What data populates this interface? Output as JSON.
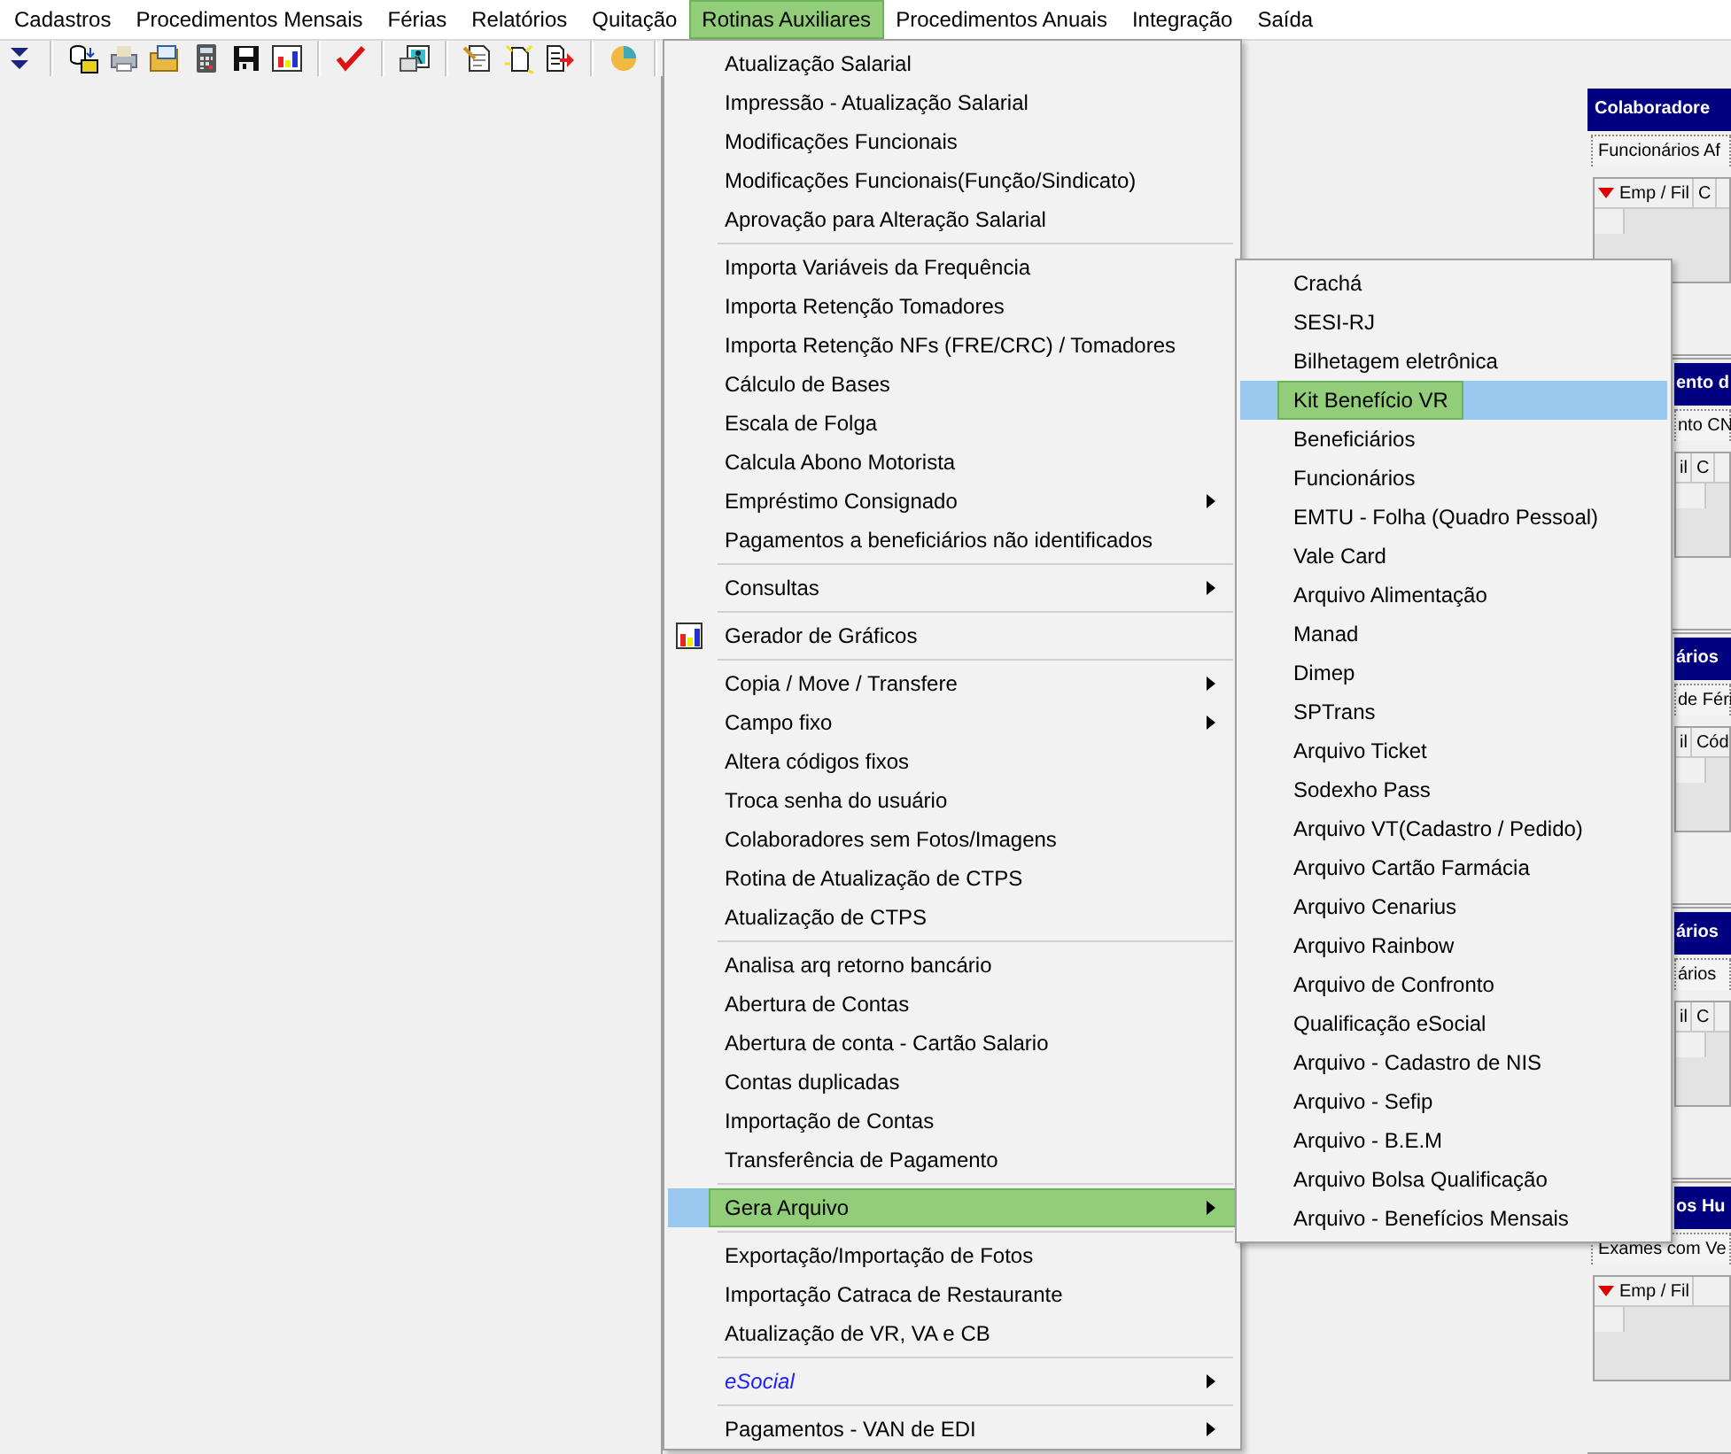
{
  "menubar": [
    {
      "label": "Cadastros",
      "selected": false
    },
    {
      "label": "Procedimentos Mensais",
      "selected": false
    },
    {
      "label": "Férias",
      "selected": false
    },
    {
      "label": "Relatórios",
      "selected": false
    },
    {
      "label": "Quitação",
      "selected": false
    },
    {
      "label": "Rotinas Auxiliares",
      "selected": true
    },
    {
      "label": "Procedimentos Anuais",
      "selected": false
    },
    {
      "label": "Integração",
      "selected": false
    },
    {
      "label": "Saída",
      "selected": false
    }
  ],
  "panels": [
    {
      "title": "Colaboradore",
      "tab": "Funcionários Af",
      "columns": [
        "Emp / Fil",
        "C"
      ],
      "sort_marker": true,
      "title_covered": false,
      "body_covered": false
    },
    {
      "title": "ento d",
      "tab": "nto CN",
      "columns": [
        "il",
        "C"
      ],
      "sort_marker": false,
      "title_covered": true,
      "body_covered": true
    },
    {
      "title": "ários",
      "tab": "de Féri",
      "columns": [
        "il",
        "Cód"
      ],
      "sort_marker": false,
      "title_covered": true,
      "body_covered": true
    },
    {
      "title": "ários",
      "tab": "ários",
      "columns": [
        "il",
        "C"
      ],
      "sort_marker": false,
      "title_covered": true,
      "body_covered": true
    },
    {
      "title": "os Hu",
      "tab": "Exames com Ve",
      "columns": [
        "Emp / Fil"
      ],
      "sort_marker": true,
      "title_covered": true,
      "body_covered": false
    }
  ],
  "menu": [
    {
      "kind": "item",
      "label": "Atualização Salarial",
      "submenu": false,
      "selected": false
    },
    {
      "kind": "item",
      "label": "Impressão - Atualização Salarial",
      "submenu": false,
      "selected": false
    },
    {
      "kind": "item",
      "label": "Modificações Funcionais",
      "submenu": false,
      "selected": false
    },
    {
      "kind": "item",
      "label": "Modificações Funcionais(Função/Sindicato)",
      "submenu": false,
      "selected": false
    },
    {
      "kind": "item",
      "label": "Aprovação para Alteração Salarial",
      "submenu": false,
      "selected": false
    },
    {
      "kind": "separator"
    },
    {
      "kind": "item",
      "label": "Importa Variáveis da Frequência",
      "submenu": false,
      "selected": false
    },
    {
      "kind": "item",
      "label": "Importa Retenção Tomadores",
      "submenu": false,
      "selected": false
    },
    {
      "kind": "item",
      "label": "Importa Retenção NFs (FRE/CRC) / Tomadores",
      "submenu": false,
      "selected": false
    },
    {
      "kind": "item",
      "label": "Cálculo de Bases",
      "submenu": false,
      "selected": false
    },
    {
      "kind": "item",
      "label": "Escala de Folga",
      "submenu": false,
      "selected": false
    },
    {
      "kind": "item",
      "label": "Calcula Abono Motorista",
      "submenu": false,
      "selected": false
    },
    {
      "kind": "item",
      "label": "Empréstimo Consignado",
      "submenu": true,
      "selected": false
    },
    {
      "kind": "item",
      "label": "Pagamentos a beneficiários não identificados",
      "submenu": false,
      "selected": false
    },
    {
      "kind": "separator"
    },
    {
      "kind": "item",
      "label": "Consultas",
      "submenu": true,
      "selected": false
    },
    {
      "kind": "separator"
    },
    {
      "kind": "chart-item",
      "label": "Gerador de Gráficos",
      "submenu": false,
      "selected": false
    },
    {
      "kind": "separator"
    },
    {
      "kind": "item",
      "label": "Copia / Move / Transfere",
      "submenu": true,
      "selected": false
    },
    {
      "kind": "item",
      "label": "Campo fixo",
      "submenu": true,
      "selected": false
    },
    {
      "kind": "item",
      "label": "Altera códigos fixos",
      "submenu": false,
      "selected": false
    },
    {
      "kind": "item",
      "label": "Troca senha do usuário",
      "submenu": false,
      "selected": false
    },
    {
      "kind": "item",
      "label": "Colaboradores sem Fotos/Imagens",
      "submenu": false,
      "selected": false
    },
    {
      "kind": "item",
      "label": "Rotina de Atualização de CTPS",
      "submenu": false,
      "selected": false
    },
    {
      "kind": "item",
      "label": "Atualização de CTPS",
      "submenu": false,
      "selected": false
    },
    {
      "kind": "separator"
    },
    {
      "kind": "item",
      "label": "Analisa arq retorno bancário",
      "submenu": false,
      "selected": false
    },
    {
      "kind": "item",
      "label": "Abertura de Contas",
      "submenu": false,
      "selected": false
    },
    {
      "kind": "item",
      "label": "Abertura de conta - Cartão Salario",
      "submenu": false,
      "selected": false
    },
    {
      "kind": "item",
      "label": "Contas duplicadas",
      "submenu": false,
      "selected": false
    },
    {
      "kind": "item",
      "label": "Importação de Contas",
      "submenu": false,
      "selected": false
    },
    {
      "kind": "item",
      "label": "Transferência de Pagamento",
      "submenu": false,
      "selected": false
    },
    {
      "kind": "separator"
    },
    {
      "kind": "item",
      "label": "Gera Arquivo",
      "submenu": true,
      "selected": true
    },
    {
      "kind": "separator"
    },
    {
      "kind": "item",
      "label": "Exportação/Importação de Fotos",
      "submenu": false,
      "selected": false
    },
    {
      "kind": "item",
      "label": "Importação Catraca de Restaurante",
      "submenu": false,
      "selected": false
    },
    {
      "kind": "item",
      "label": "Atualização de VR, VA e CB",
      "submenu": false,
      "selected": false
    },
    {
      "kind": "separator"
    },
    {
      "kind": "accent-item",
      "label": "eSocial",
      "submenu": true,
      "selected": false
    },
    {
      "kind": "separator"
    },
    {
      "kind": "item",
      "label": "Pagamentos - VAN de EDI",
      "submenu": true,
      "selected": false
    }
  ],
  "submenu": [
    {
      "label": "Crachá",
      "selected": false
    },
    {
      "label": "SESI-RJ",
      "selected": false
    },
    {
      "label": "Bilhetagem eletrônica",
      "selected": false
    },
    {
      "label": "Kit Benefício VR",
      "selected": true
    },
    {
      "label": "Beneficiários",
      "selected": false
    },
    {
      "label": "Funcionários",
      "selected": false
    },
    {
      "label": "EMTU - Folha (Quadro Pessoal)",
      "selected": false
    },
    {
      "label": "Vale Card",
      "selected": false
    },
    {
      "label": "Arquivo Alimentação",
      "selected": false
    },
    {
      "label": "Manad",
      "selected": false
    },
    {
      "label": "Dimep",
      "selected": false
    },
    {
      "label": "SPTrans",
      "selected": false
    },
    {
      "label": "Arquivo Ticket",
      "selected": false
    },
    {
      "label": "Sodexho Pass",
      "selected": false
    },
    {
      "label": "Arquivo VT(Cadastro / Pedido)",
      "selected": false
    },
    {
      "label": "Arquivo Cartão Farmácia",
      "selected": false
    },
    {
      "label": "Arquivo Cenarius",
      "selected": false
    },
    {
      "label": "Arquivo Rainbow",
      "selected": false
    },
    {
      "label": "Arquivo de Confronto",
      "selected": false
    },
    {
      "label": "Qualificação eSocial",
      "selected": false
    },
    {
      "label": "Arquivo - Cadastro de NIS",
      "selected": false
    },
    {
      "label": "Arquivo - Sefip",
      "selected": false
    },
    {
      "label": "Arquivo - B.E.M",
      "selected": false
    },
    {
      "label": "Arquivo Bolsa Qualificação",
      "selected": false
    },
    {
      "label": "Arquivo - Benefícios Mensais",
      "selected": false
    }
  ]
}
